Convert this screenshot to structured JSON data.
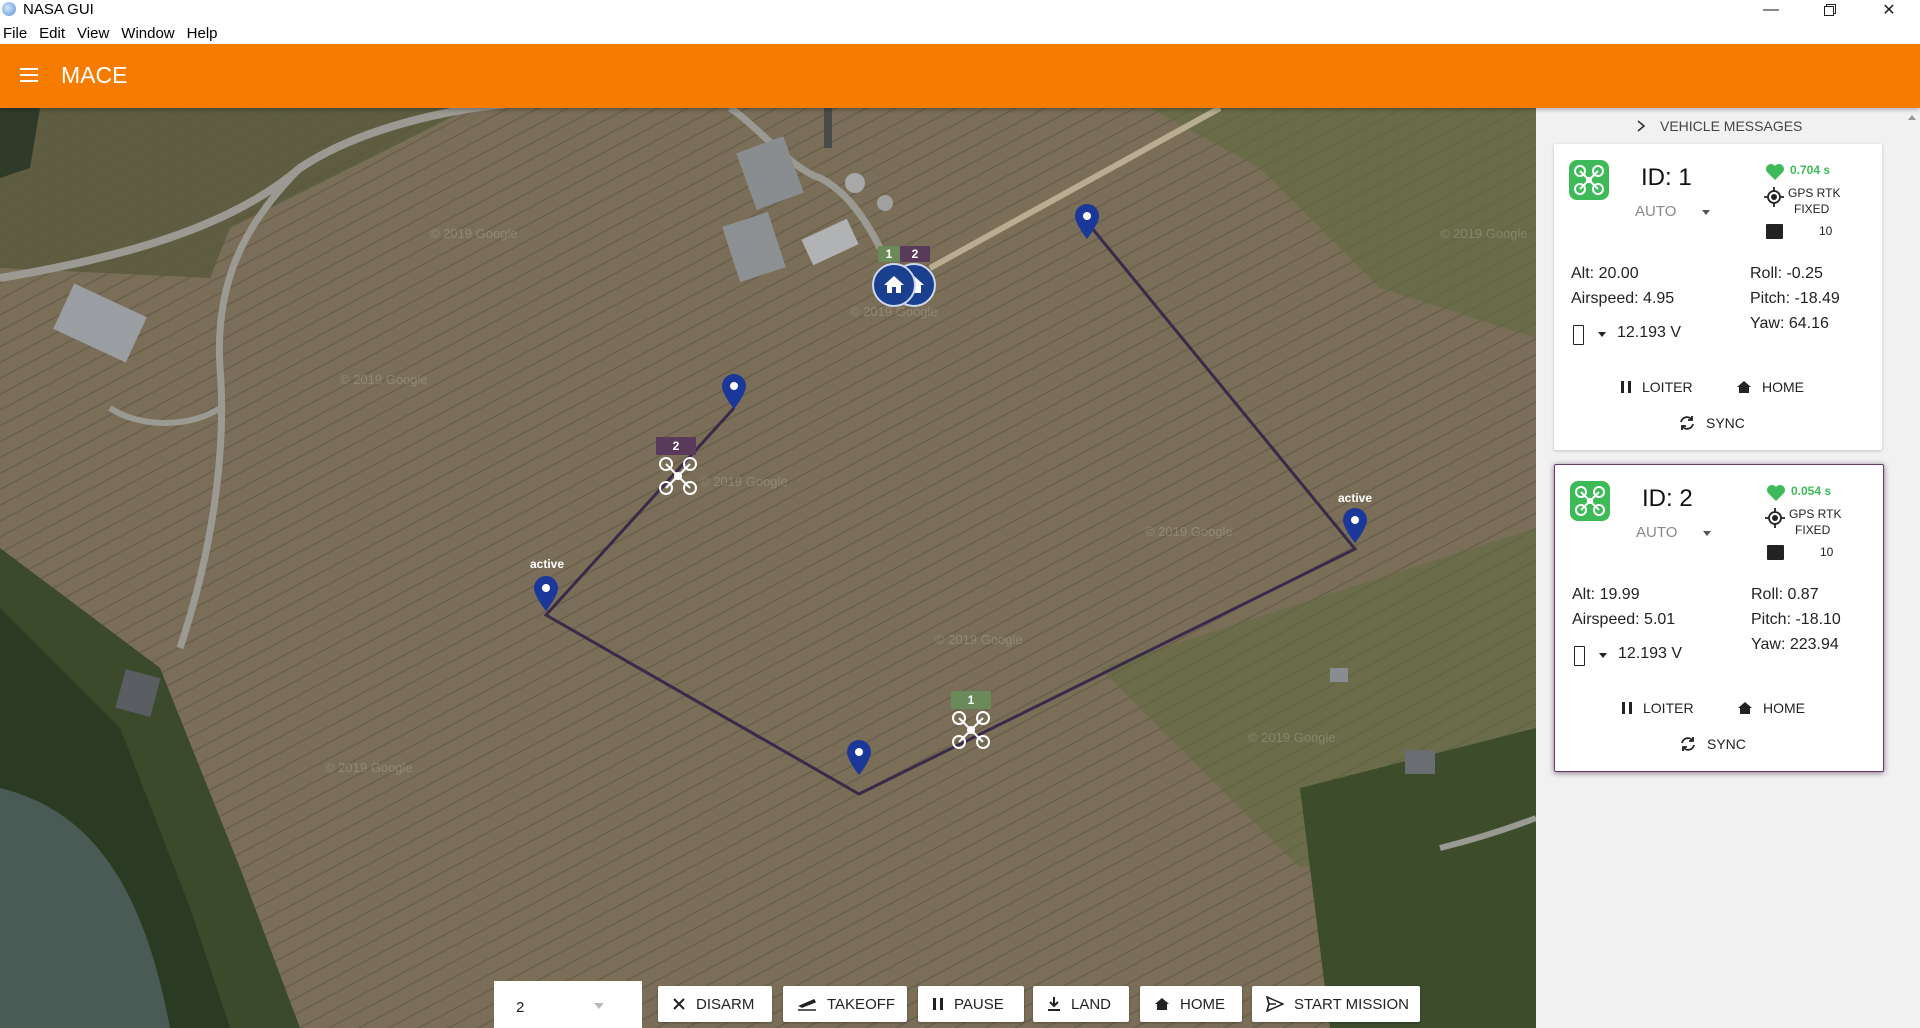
{
  "window": {
    "title": "NASA GUI"
  },
  "menu": [
    "File",
    "Edit",
    "View",
    "Window",
    "Help"
  ],
  "header": {
    "title": "MACE"
  },
  "map": {
    "watermark": "© 2019 Google",
    "active_label": "active",
    "drone_tags": [
      "2",
      "1"
    ],
    "home_tags": [
      "1",
      "2"
    ]
  },
  "toolbar": {
    "vehicle_select_value": "2",
    "buttons": [
      "DISARM",
      "TAKEOFF",
      "PAUSE",
      "LAND",
      "HOME",
      "START MISSION"
    ]
  },
  "panel": {
    "header": "VEHICLE MESSAGES",
    "vehicles": [
      {
        "id_label": "ID: 1",
        "mode": "AUTO",
        "heartbeat": "0.704 s",
        "gps_line1": "GPS RTK",
        "gps_line2": "FIXED",
        "images": "10",
        "alt": "Alt: 20.00",
        "airspeed": "Airspeed: 4.95",
        "voltage": "12.193 V",
        "roll": "Roll: -0.25",
        "pitch": "Pitch: -18.49",
        "yaw": "Yaw: 64.16",
        "btn_loiter": "LOITER",
        "btn_home": "HOME",
        "btn_sync": "SYNC"
      },
      {
        "id_label": "ID: 2",
        "mode": "AUTO",
        "heartbeat": "0.054 s",
        "gps_line1": "GPS RTK",
        "gps_line2": "FIXED",
        "images": "10",
        "alt": "Alt: 19.99",
        "airspeed": "Airspeed: 5.01",
        "voltage": "12.193 V",
        "roll": "Roll: 0.87",
        "pitch": "Pitch: -18.10",
        "yaw": "Yaw: 223.94",
        "btn_loiter": "LOITER",
        "btn_home": "HOME",
        "btn_sync": "SYNC"
      }
    ]
  },
  "colors": {
    "header": "#f57c00",
    "path": "#3a2a4a",
    "marker": "#1a3799",
    "healthy": "#3fba58",
    "drone2_tag": "#5a3a5a",
    "drone1_tag": "#6a8a5a"
  }
}
